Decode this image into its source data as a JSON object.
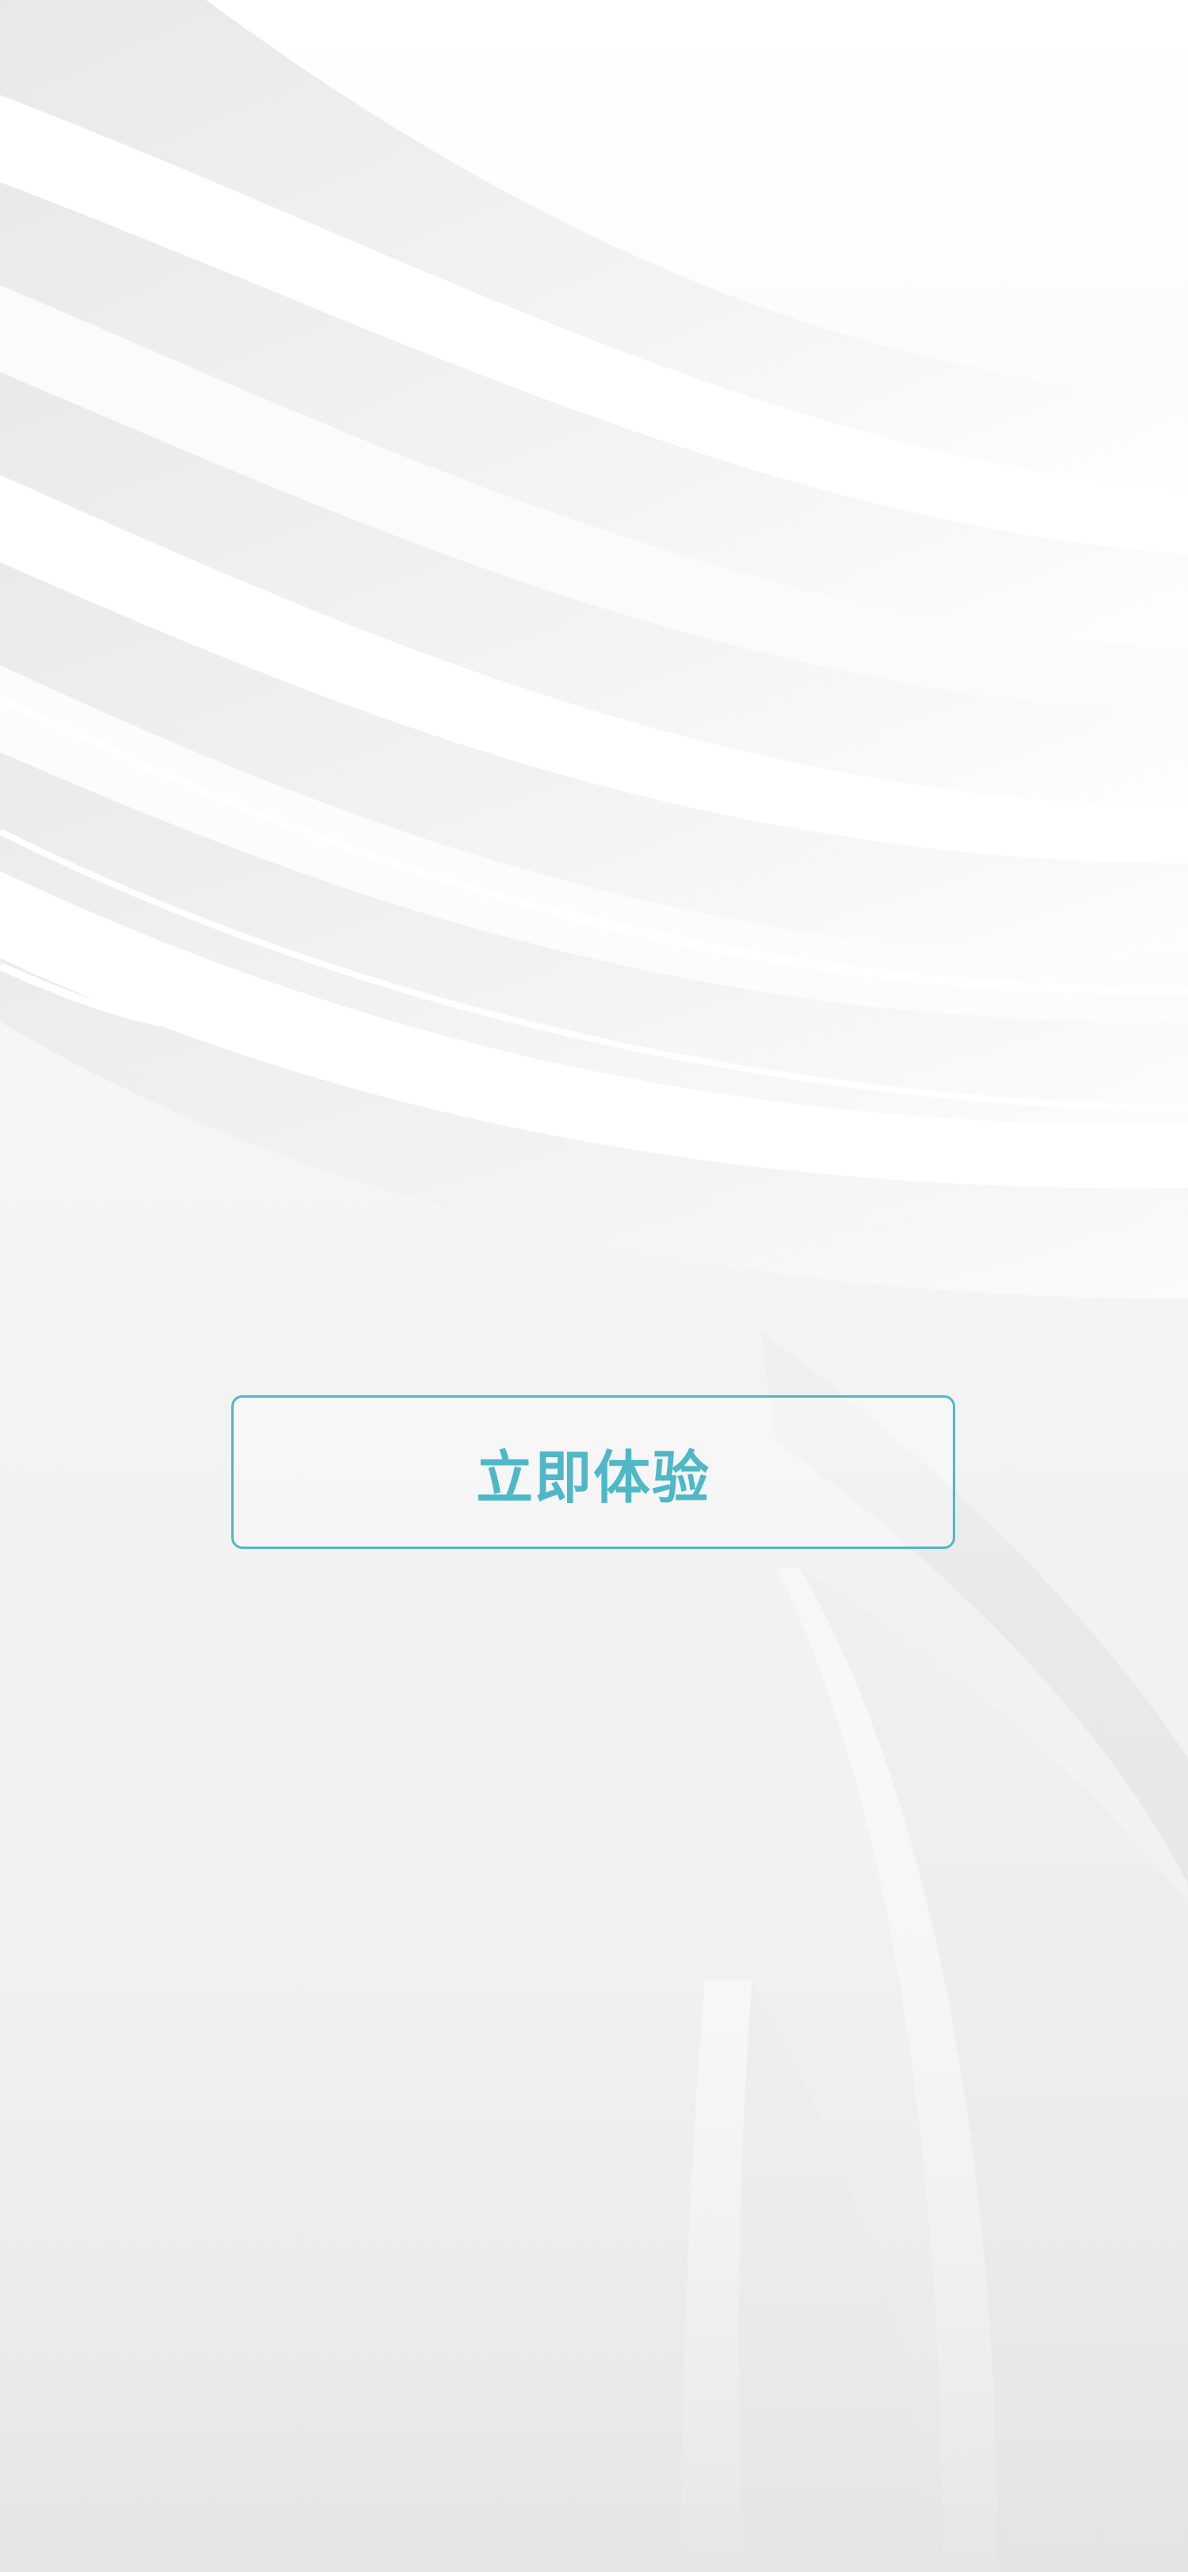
{
  "start_button": {
    "label": "立即体验"
  },
  "colors": {
    "accent": "#4fb8c6",
    "background": "#f4f4f4"
  }
}
